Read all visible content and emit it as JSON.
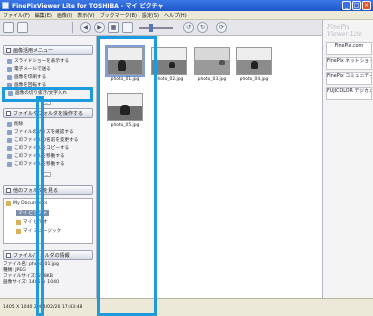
{
  "window": {
    "title": "FinePixViewer Lite for TOSHIBA - マイ ピクチャ",
    "min": "_",
    "max": "□",
    "close": "×"
  },
  "menubar": [
    "ファイル(F)",
    "編集(E)",
    "画像(I)",
    "表示(V)",
    "ブックマーク(B)",
    "設定(S)",
    "ヘルプ(H)"
  ],
  "toolbar": {
    "back": "◀",
    "forward": "▶",
    "view_toggle": "▦",
    "rotate_left": "↺",
    "rotate_right": "↻",
    "refresh": "⟳"
  },
  "left_panel": {
    "sections": {
      "menu": "画像活用メニュー",
      "file_ops": "ファイルやフォルダを操作する",
      "folders": "他のフォルダを見る",
      "info": "ファイル/フォルダの情報"
    },
    "menu_items": [
      "スライドショーを表示する",
      "電子メールで送る",
      "画像を印刷する",
      "画像を回転する",
      "画像の切り抜き/文字入れ"
    ],
    "file_items": [
      "削除",
      "ファイルのサイズを確認する",
      "このファイルの名前を変更する",
      "このファイルをコピーする",
      "このファイルを移動する",
      "このファイルを移動する"
    ],
    "tree": {
      "root": "My Documents",
      "selected": "マイ ピクチャ",
      "video": "マイ ビデオ",
      "music": "マイ ミュージック"
    },
    "info": {
      "filename": "ファイル名: photo_01.jpg",
      "type": "種類: JPEG",
      "size": "ファイルサイズ: 218KB",
      "dimensions": "画像サイズ: 1405 × 1040"
    }
  },
  "thumbnails": [
    {
      "name": "photo_01.jpg",
      "selected": true
    },
    {
      "name": "photo_02.jpg",
      "selected": false
    },
    {
      "name": "photo_03.jpg",
      "selected": false
    },
    {
      "name": "photo_04.jpg",
      "selected": false
    },
    {
      "name": "photo_05.jpg",
      "selected": false
    }
  ],
  "right_panel": {
    "logo": "FinePix Viewer Lite",
    "links": [
      "FinePix.com",
      "FinePix ネットショップ",
      "FinePix コミュニティ",
      "FUJICOLOR デジカメプリント"
    ]
  },
  "status": {
    "text": "1405 X 1040  2004/02/26 17:43:48"
  },
  "colors": {
    "highlight": "#1e9bdc",
    "titlebar": "#1d56c9"
  }
}
